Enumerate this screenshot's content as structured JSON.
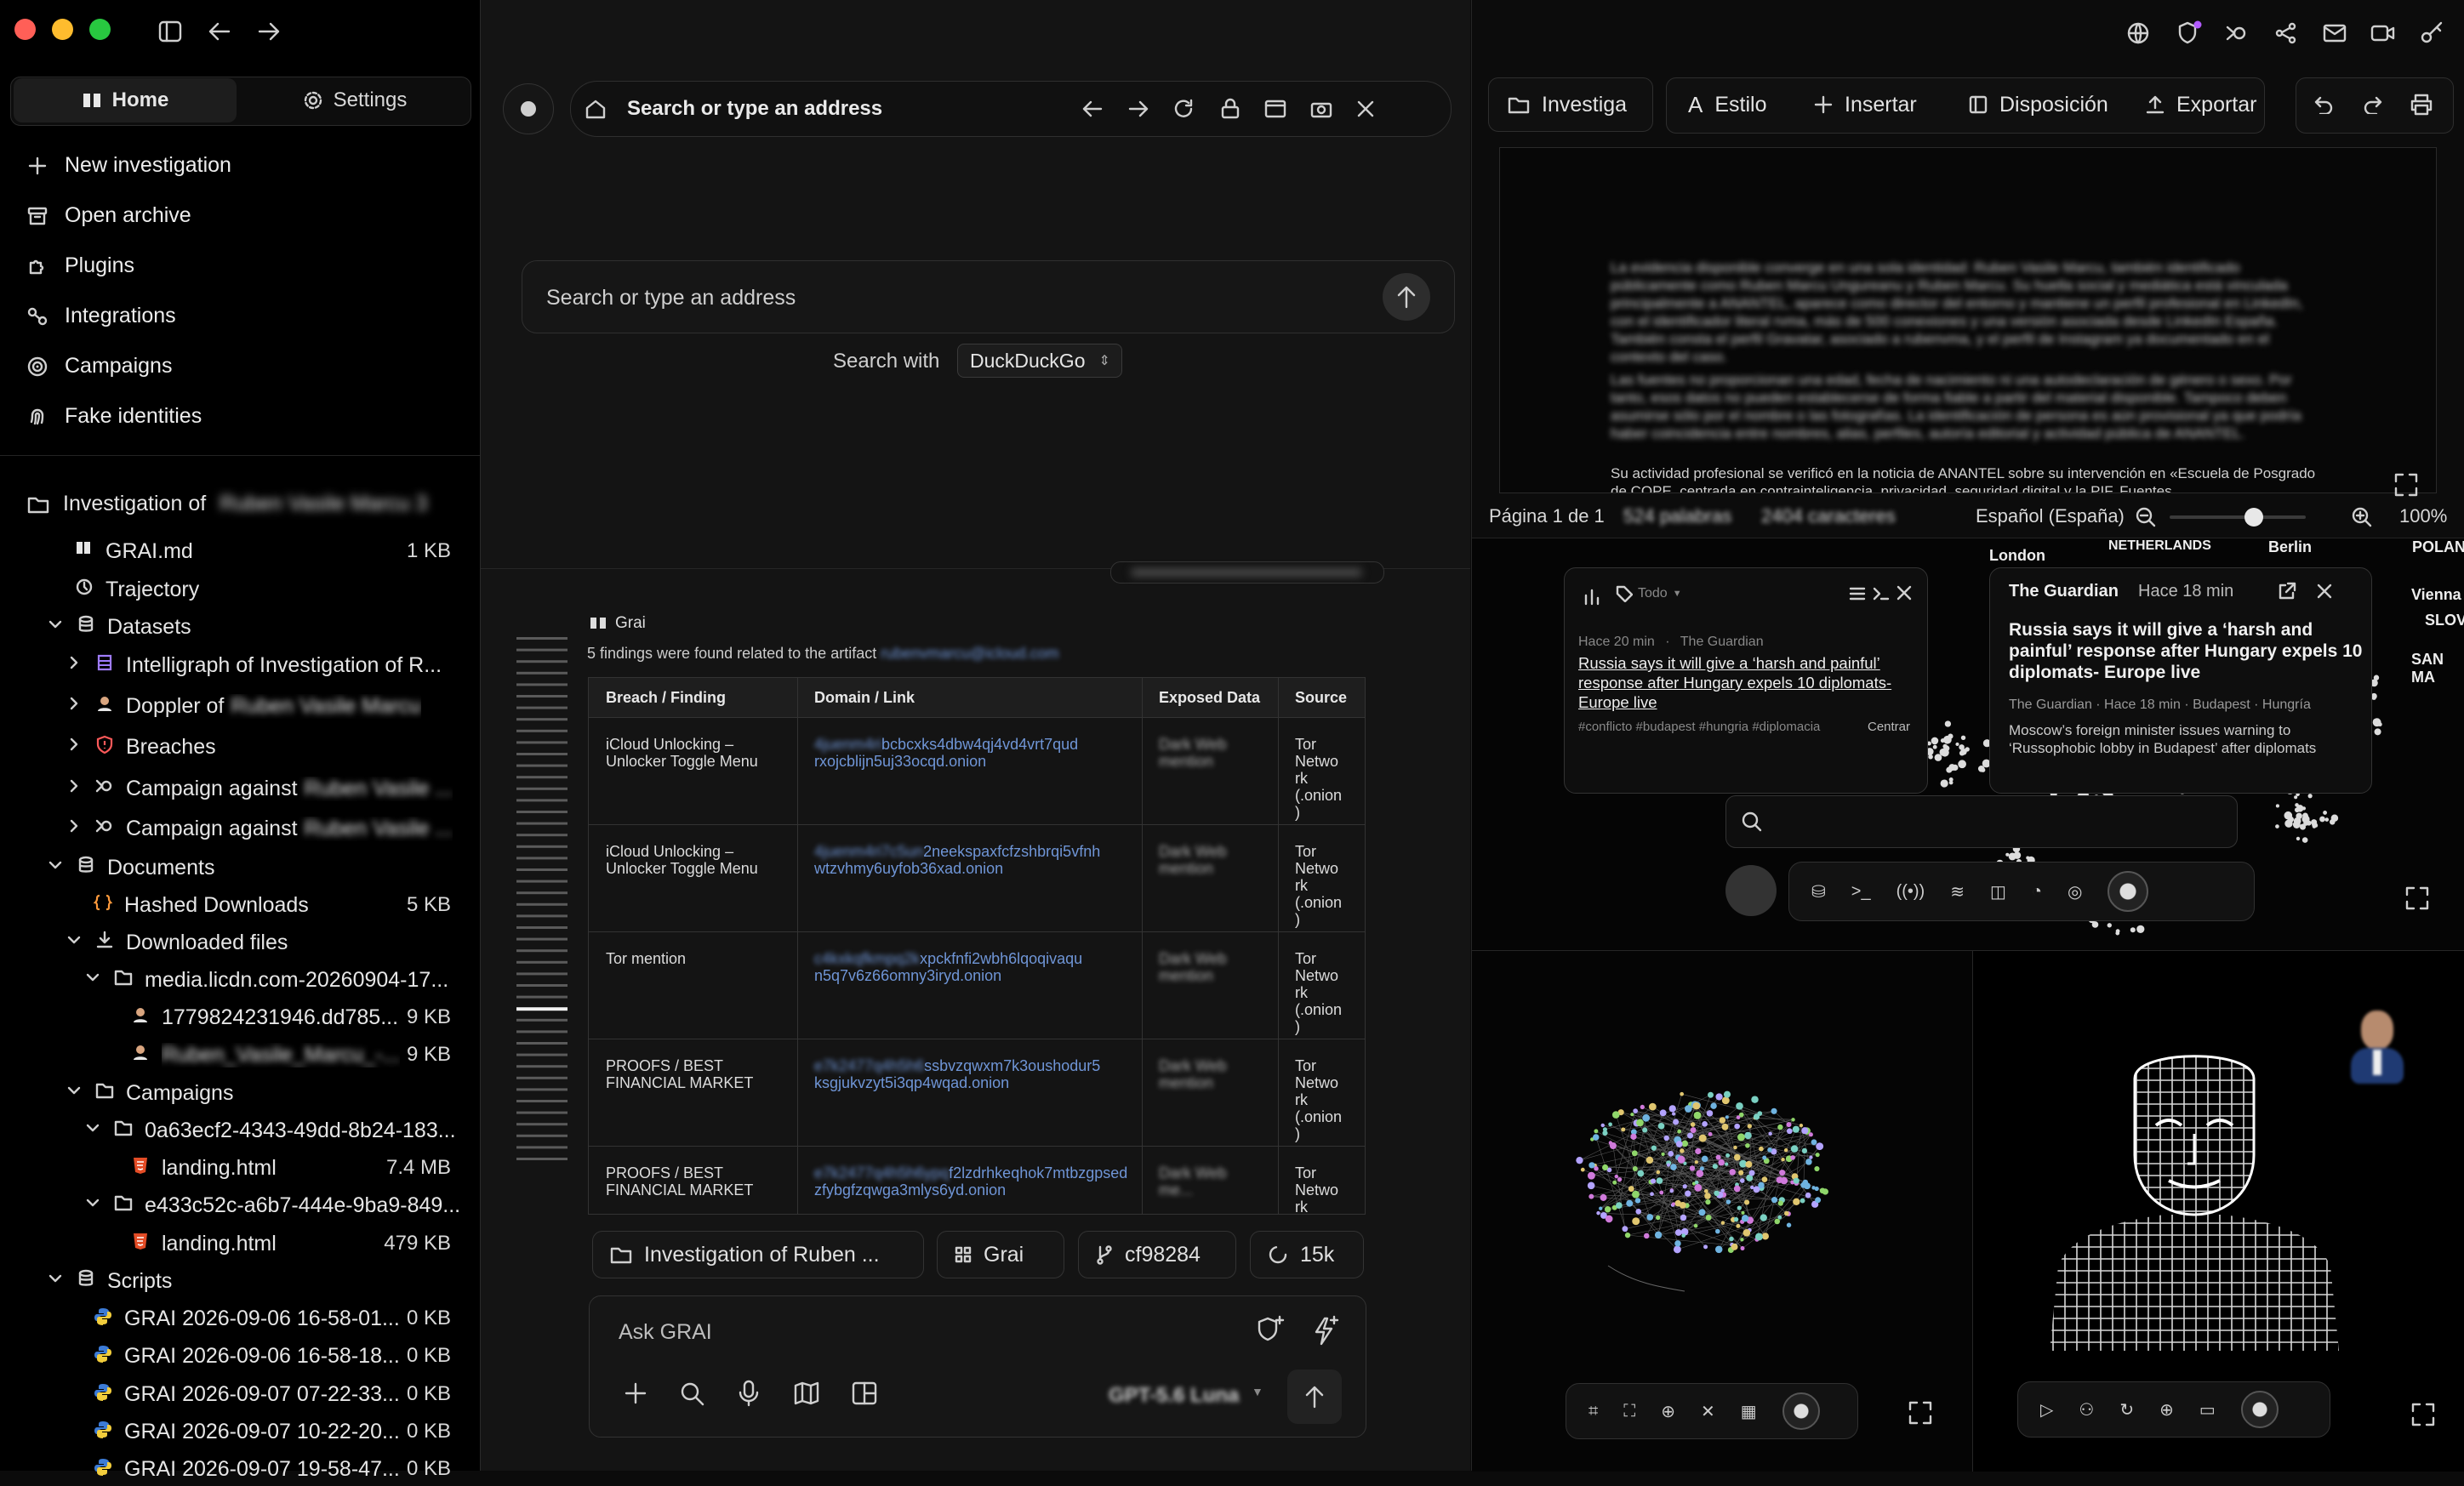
{
  "window": {
    "traffic_colors": [
      "#ff5f57",
      "#febc2e",
      "#28c840"
    ]
  },
  "sidebar": {
    "tabs": [
      {
        "label": "Home",
        "icon": "book-open-icon"
      },
      {
        "label": "Settings",
        "icon": "gear-icon"
      }
    ],
    "nav": [
      {
        "label": "New investigation",
        "icon": "plus-icon"
      },
      {
        "label": "Open archive",
        "icon": "archive-icon"
      },
      {
        "label": "Plugins",
        "icon": "puzzle-icon"
      },
      {
        "label": "Integrations",
        "icon": "link-icon"
      },
      {
        "label": "Campaigns",
        "icon": "target-icon"
      },
      {
        "label": "Fake identities",
        "icon": "fingerprint-icon"
      }
    ],
    "investigation": {
      "prefix": "Investigation of",
      "name_blurred": "Ruben Vasile Marcu 3"
    },
    "tree": [
      {
        "label": "GRAI.md",
        "size": "1 KB",
        "icon": "book-icon"
      },
      {
        "label": "Trajectory",
        "size": "",
        "icon": "clock-icon"
      },
      {
        "label": "Datasets",
        "size": "",
        "icon": "database-icon"
      },
      {
        "label": "Intelligraph of Investigation of R...",
        "size": "",
        "icon": "graph-icon"
      },
      {
        "label": "Doppler of",
        "blurred": "Ruben Vasile Marcu",
        "size": "",
        "icon": "avatar-icon"
      },
      {
        "label": "Breaches",
        "size": "",
        "icon": "shield-alert-icon"
      },
      {
        "label": "Campaign against",
        "blurred": "Ruben Vasile ...",
        "size": "",
        "icon": "campaign-icon"
      },
      {
        "label": "Campaign against",
        "blurred": "Ruben Vasile ...",
        "size": "",
        "icon": "campaign-icon"
      },
      {
        "label": "Documents",
        "size": "",
        "icon": "database-icon"
      },
      {
        "label": "Hashed Downloads",
        "size": "5 KB",
        "icon": "braces-icon"
      },
      {
        "label": "Downloaded files",
        "size": "",
        "icon": "download-icon"
      },
      {
        "label": "media.licdn.com-20260904-17...",
        "size": "",
        "icon": "folder-icon"
      },
      {
        "label": "1779824231946.dd785...",
        "size": "9 KB",
        "icon": "avatar-icon"
      },
      {
        "label": "",
        "blurred": "Ruben_Vasile_Marcu_-...",
        "size": "9 KB",
        "icon": "avatar-icon"
      },
      {
        "label": "Campaigns",
        "size": "",
        "icon": "folder-icon"
      },
      {
        "label": "0a63ecf2-4343-49dd-8b24-183...",
        "size": "",
        "icon": "folder-icon"
      },
      {
        "label": "landing.html",
        "size": "7.4 MB",
        "icon": "html-icon"
      },
      {
        "label": "e433c52c-a6b7-444e-9ba9-849...",
        "size": "",
        "icon": "folder-icon"
      },
      {
        "label": "landing.html",
        "size": "479 KB",
        "icon": "html-icon"
      },
      {
        "label": "Scripts",
        "size": "",
        "icon": "database-icon"
      },
      {
        "label": "GRAI 2026-09-06 16-58-01...",
        "size": "0 KB",
        "icon": "python-icon"
      },
      {
        "label": "GRAI 2026-09-06 16-58-18...",
        "size": "0 KB",
        "icon": "python-icon"
      },
      {
        "label": "GRAI 2026-09-07 07-22-33...",
        "size": "0 KB",
        "icon": "python-icon"
      },
      {
        "label": "GRAI 2026-09-07 10-22-20...",
        "size": "0 KB",
        "icon": "python-icon"
      },
      {
        "label": "GRAI 2026-09-07 19-58-47...",
        "size": "0 KB",
        "icon": "python-icon"
      }
    ]
  },
  "browser": {
    "address_placeholder": "Search or type an address",
    "search_placeholder": "Search or type an address",
    "search_with_label": "Search with",
    "engine": "DuckDuckGo"
  },
  "chat": {
    "agent_name": "Grai",
    "summary_prefix": "5 findings were found related to the artifact",
    "summary_blurred": "rubenvmarcu@icloud.com",
    "columns": [
      "Breach / Finding",
      "Domain / Link",
      "Exposed Data",
      "Source"
    ],
    "rows": [
      {
        "finding": "iCloud Unlocking – Unlocker Toggle Menu",
        "link_blur": "4juenm4ri",
        "link_a": "bcbcxks4dbw4qj4vd4vrt7qud",
        "link_b": "rxojcblijn5uj33ocqd.onion",
        "exposed": "Dark Web mention",
        "source": "Tor Netwo rk (.onion )"
      },
      {
        "finding": "iCloud Unlocking – Unlocker Toggle Menu",
        "link_blur": "4juenm4ri7c5un",
        "link_a": "2neekspaxfcfzshbrqi5vfnh",
        "link_b": "wtzvhmy6uyfob36xad.onion",
        "exposed": "Dark Web mention",
        "source": "Tor Netwo rk (.onion )"
      },
      {
        "finding": "Tor mention",
        "link_blur": "c4kxkqfkmpq2k",
        "link_a": "xpckfnfi2wbh6lqoqivaqu",
        "link_b": "n5q7v6z66omny3iryd.onion",
        "exposed": "Dark Web mention",
        "source": "Tor Netwo rk (.onion )"
      },
      {
        "finding": "PROOFS / BEST FINANCIAL MARKET",
        "link_blur": "e7k2477q4h5h6",
        "link_a": "ssbvzqwxm7k3oushodur5",
        "link_b": "ksgjukvzyt5i3qp4wqad.onion",
        "exposed": "Dark Web mention",
        "source": "Tor Netwo rk (.onion )"
      },
      {
        "finding": "PROOFS / BEST FINANCIAL MARKET",
        "link_blur": "e7k2477q4h5h6ypq",
        "link_a": "f2lzdrhkeqhok7mtbzgpsed",
        "link_b": "zfybgfzqwga3mlys6yd.onion",
        "exposed": "Dark Web me...",
        "source": "Tor Netwo rk"
      }
    ],
    "chips": [
      {
        "label": "Investigation of Ruben ...",
        "icon": "folder-icon"
      },
      {
        "label": "Grai",
        "icon": "grid-icon"
      },
      {
        "label": "cf98284",
        "icon": "branch-icon"
      },
      {
        "label": "15k",
        "icon": "spinner-icon"
      }
    ],
    "input_placeholder": "Ask GRAI",
    "model": "GPT-5.6 Luna"
  },
  "editor": {
    "toolbar": [
      {
        "label": "Investiga",
        "icon": "folder-icon"
      },
      {
        "label": "Estilo",
        "icon": "text-icon"
      },
      {
        "label": "Insertar",
        "icon": "plus-icon"
      },
      {
        "label": "Disposición",
        "icon": "layout-icon"
      },
      {
        "label": "Exportar",
        "icon": "upload-icon"
      }
    ],
    "doc_blurred_1": "La evidencia disponible converge en una sola identidad: Ruben Vasile Marcu, también identificado públicamente como Ruben Marcu Ungureanu y Ruben Marcu. Su huella social y mediática está vinculada principalmente a ANANTEL, aparece como director del entorno y mantiene un perfil profesional en LinkedIn, con el identificador literal rvma, más de 500 conexiones y una versión asociada desde LinkedIn España. También consta el perfil Gravatar, asociado a rubenvma, y el perfil de Instagram ya documentado en el contexto del caso.",
    "doc_blurred_2": "Las fuentes no proporcionan una edad, fecha de nacimiento ni una autodeclaración de género o sexo. Por tanto, esos datos no pueden establecerse de forma fiable a partir del material disponible. Tampoco deben asumirse sólo por el nombre o las fotografías. La identificación de persona es aún provisional ya que podría haber coincidencia entre nombres, alias, perfiles, autoría editorial y actividad pública de ANANTEL.",
    "doc_visible_3": "Su actividad profesional se verificó en la noticia de ANANTEL sobre su intervención en «Escuela de Posgrado de COPE, centrada en contrainteligencia, privacidad, seguridad digital y la PIF. Fuentes",
    "page": "Página 1 de 1",
    "words": "524 palabras",
    "chars": "2404 caracteres",
    "language": "Español (España)",
    "zoom": "100%",
    "zoom_level": 0.62
  },
  "map": {
    "labels": [
      "London",
      "NETHERLANDS",
      "Berlin",
      "POLAND",
      "Vienna",
      "SLOV",
      "SAN MA"
    ],
    "filter_label": "Todo",
    "card_left": {
      "time": "Hace 20 min",
      "source": "The Guardian",
      "headline": "Russia says it will give a ‘harsh and painful’ response after Hungary expels 10 diplomats- Europe live",
      "tags": "#conflicto #budapest #hungria #diplomacia",
      "action": "Centrar"
    },
    "card_right": {
      "source": "The Guardian",
      "time": "Hace 18 min",
      "headline": "Russia says it will give a ‘harsh and painful’ response after Hungary expels 10 diplomats- Europe live",
      "meta": "The Guardian · Hace 18 min · Budapest · Hungría",
      "body": "Moscow’s foreign minister issues warning to ‘Russophobic lobby in Budapest’ after diplomats"
    }
  }
}
